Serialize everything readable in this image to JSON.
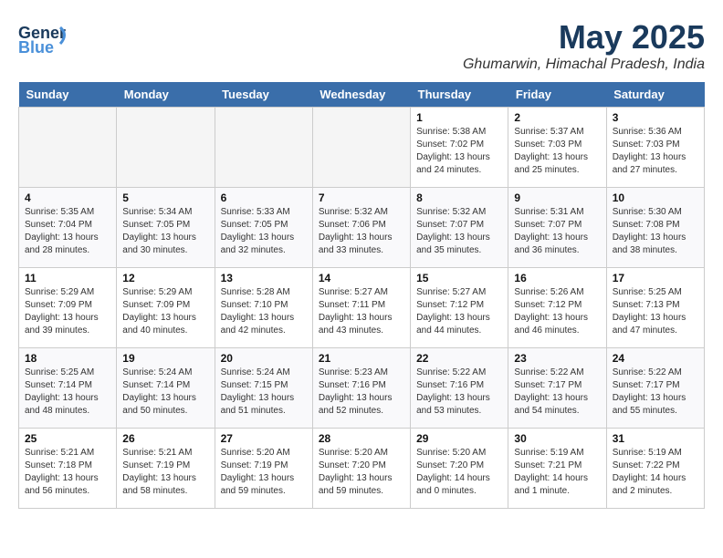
{
  "header": {
    "logo_line1": "General",
    "logo_line2": "Blue",
    "month": "May 2025",
    "location": "Ghumarwin, Himachal Pradesh, India"
  },
  "columns": [
    "Sunday",
    "Monday",
    "Tuesday",
    "Wednesday",
    "Thursday",
    "Friday",
    "Saturday"
  ],
  "weeks": [
    [
      {
        "day": "",
        "info": ""
      },
      {
        "day": "",
        "info": ""
      },
      {
        "day": "",
        "info": ""
      },
      {
        "day": "",
        "info": ""
      },
      {
        "day": "1",
        "info": "Sunrise: 5:38 AM\nSunset: 7:02 PM\nDaylight: 13 hours\nand 24 minutes."
      },
      {
        "day": "2",
        "info": "Sunrise: 5:37 AM\nSunset: 7:03 PM\nDaylight: 13 hours\nand 25 minutes."
      },
      {
        "day": "3",
        "info": "Sunrise: 5:36 AM\nSunset: 7:03 PM\nDaylight: 13 hours\nand 27 minutes."
      }
    ],
    [
      {
        "day": "4",
        "info": "Sunrise: 5:35 AM\nSunset: 7:04 PM\nDaylight: 13 hours\nand 28 minutes."
      },
      {
        "day": "5",
        "info": "Sunrise: 5:34 AM\nSunset: 7:05 PM\nDaylight: 13 hours\nand 30 minutes."
      },
      {
        "day": "6",
        "info": "Sunrise: 5:33 AM\nSunset: 7:05 PM\nDaylight: 13 hours\nand 32 minutes."
      },
      {
        "day": "7",
        "info": "Sunrise: 5:32 AM\nSunset: 7:06 PM\nDaylight: 13 hours\nand 33 minutes."
      },
      {
        "day": "8",
        "info": "Sunrise: 5:32 AM\nSunset: 7:07 PM\nDaylight: 13 hours\nand 35 minutes."
      },
      {
        "day": "9",
        "info": "Sunrise: 5:31 AM\nSunset: 7:07 PM\nDaylight: 13 hours\nand 36 minutes."
      },
      {
        "day": "10",
        "info": "Sunrise: 5:30 AM\nSunset: 7:08 PM\nDaylight: 13 hours\nand 38 minutes."
      }
    ],
    [
      {
        "day": "11",
        "info": "Sunrise: 5:29 AM\nSunset: 7:09 PM\nDaylight: 13 hours\nand 39 minutes."
      },
      {
        "day": "12",
        "info": "Sunrise: 5:29 AM\nSunset: 7:09 PM\nDaylight: 13 hours\nand 40 minutes."
      },
      {
        "day": "13",
        "info": "Sunrise: 5:28 AM\nSunset: 7:10 PM\nDaylight: 13 hours\nand 42 minutes."
      },
      {
        "day": "14",
        "info": "Sunrise: 5:27 AM\nSunset: 7:11 PM\nDaylight: 13 hours\nand 43 minutes."
      },
      {
        "day": "15",
        "info": "Sunrise: 5:27 AM\nSunset: 7:12 PM\nDaylight: 13 hours\nand 44 minutes."
      },
      {
        "day": "16",
        "info": "Sunrise: 5:26 AM\nSunset: 7:12 PM\nDaylight: 13 hours\nand 46 minutes."
      },
      {
        "day": "17",
        "info": "Sunrise: 5:25 AM\nSunset: 7:13 PM\nDaylight: 13 hours\nand 47 minutes."
      }
    ],
    [
      {
        "day": "18",
        "info": "Sunrise: 5:25 AM\nSunset: 7:14 PM\nDaylight: 13 hours\nand 48 minutes."
      },
      {
        "day": "19",
        "info": "Sunrise: 5:24 AM\nSunset: 7:14 PM\nDaylight: 13 hours\nand 50 minutes."
      },
      {
        "day": "20",
        "info": "Sunrise: 5:24 AM\nSunset: 7:15 PM\nDaylight: 13 hours\nand 51 minutes."
      },
      {
        "day": "21",
        "info": "Sunrise: 5:23 AM\nSunset: 7:16 PM\nDaylight: 13 hours\nand 52 minutes."
      },
      {
        "day": "22",
        "info": "Sunrise: 5:22 AM\nSunset: 7:16 PM\nDaylight: 13 hours\nand 53 minutes."
      },
      {
        "day": "23",
        "info": "Sunrise: 5:22 AM\nSunset: 7:17 PM\nDaylight: 13 hours\nand 54 minutes."
      },
      {
        "day": "24",
        "info": "Sunrise: 5:22 AM\nSunset: 7:17 PM\nDaylight: 13 hours\nand 55 minutes."
      }
    ],
    [
      {
        "day": "25",
        "info": "Sunrise: 5:21 AM\nSunset: 7:18 PM\nDaylight: 13 hours\nand 56 minutes."
      },
      {
        "day": "26",
        "info": "Sunrise: 5:21 AM\nSunset: 7:19 PM\nDaylight: 13 hours\nand 58 minutes."
      },
      {
        "day": "27",
        "info": "Sunrise: 5:20 AM\nSunset: 7:19 PM\nDaylight: 13 hours\nand 59 minutes."
      },
      {
        "day": "28",
        "info": "Sunrise: 5:20 AM\nSunset: 7:20 PM\nDaylight: 13 hours\nand 59 minutes."
      },
      {
        "day": "29",
        "info": "Sunrise: 5:20 AM\nSunset: 7:20 PM\nDaylight: 14 hours\nand 0 minutes."
      },
      {
        "day": "30",
        "info": "Sunrise: 5:19 AM\nSunset: 7:21 PM\nDaylight: 14 hours\nand 1 minute."
      },
      {
        "day": "31",
        "info": "Sunrise: 5:19 AM\nSunset: 7:22 PM\nDaylight: 14 hours\nand 2 minutes."
      }
    ]
  ]
}
